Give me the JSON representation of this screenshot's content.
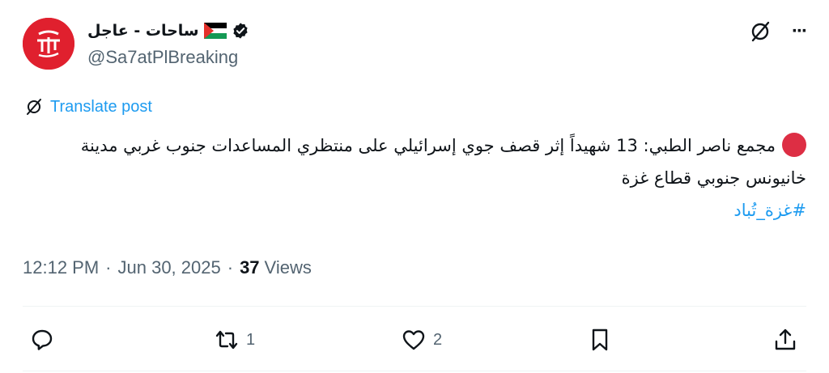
{
  "author": {
    "display_name": "ساحات - عاجل",
    "handle": "@Sa7atPlBreaking",
    "avatar_icon": "sa7at-logo",
    "flag_icon": "palestine-flag-icon",
    "verified_icon": "verified-badge-icon"
  },
  "top_actions": {
    "grok_icon": "grok-icon",
    "more_icon": "more-icon",
    "more_glyph": "···"
  },
  "translate_label": "Translate post",
  "post": {
    "line1": "مجمع ناصر الطبي: 13 شهيداً إثر قصف جوي إسرائيلي على منتظري المساعدات جنوب غربي مدينة",
    "line2": "خانيونس جنوبي قطاع غزة",
    "hashtag": "#غزة_تُباد"
  },
  "meta": {
    "time": "12:12 PM",
    "separator": "·",
    "date": "Jun 30, 2025",
    "views_count": "37",
    "views_label": "Views"
  },
  "actions": {
    "reply_icon": "reply-icon",
    "retweet_count": "1",
    "like_count": "2",
    "bookmark_icon": "bookmark-icon",
    "share_icon": "share-icon"
  },
  "colors": {
    "accent": "#1d9bf0",
    "text": "#0f1419",
    "secondary": "#536471",
    "avatar_bg": "#e0202e",
    "red_circle": "#dd2e44"
  }
}
